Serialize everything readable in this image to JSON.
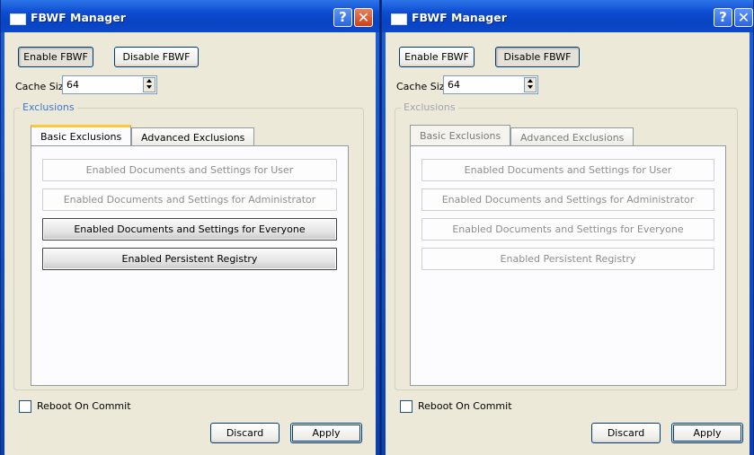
{
  "colors": {
    "title_blue": "#0843c2",
    "dialog_bg": "#ece9d8",
    "groupbox_label": "#3c76d6",
    "tab_highlight": "#ffc83c"
  },
  "windows": [
    {
      "title": "FBWF Manager",
      "help_glyph": "?",
      "close_glyph": "✕",
      "enable_label": "Enable FBWF",
      "disable_label": "Disable FBWF",
      "pressed_button": "enable",
      "cache_label": "Cache Size",
      "cache_value": "64",
      "group_label": "Exclusions",
      "tabs": [
        {
          "label": "Basic Exclusions"
        },
        {
          "label": "Advanced Exclusions"
        }
      ],
      "tabs_enabled": true,
      "exclusions": [
        {
          "label": "Enabled Documents and Settings for User",
          "enabled": false
        },
        {
          "label": "Enabled Documents and Settings for Administrator",
          "enabled": false
        },
        {
          "label": "Enabled Documents and Settings for Everyone",
          "enabled": true
        },
        {
          "label": "Enabled Persistent Registry",
          "enabled": true
        }
      ],
      "reboot_label": "Reboot On Commit",
      "discard_label": "Discard",
      "apply_label": "Apply"
    },
    {
      "title": "FBWF Manager",
      "help_glyph": "?",
      "close_glyph": "✕",
      "enable_label": "Enable FBWF",
      "disable_label": "Disable FBWF",
      "pressed_button": "disable",
      "cache_label": "Cache Size",
      "cache_value": "64",
      "group_label": "Exclusions",
      "tabs": [
        {
          "label": "Basic Exclusions"
        },
        {
          "label": "Advanced Exclusions"
        }
      ],
      "tabs_enabled": false,
      "exclusions": [
        {
          "label": "Enabled Documents and Settings for User",
          "enabled": false
        },
        {
          "label": "Enabled Documents and Settings for Administrator",
          "enabled": false
        },
        {
          "label": "Enabled Documents and Settings for Everyone",
          "enabled": false
        },
        {
          "label": "Enabled Persistent Registry",
          "enabled": false
        }
      ],
      "reboot_label": "Reboot On Commit",
      "discard_label": "Discard",
      "apply_label": "Apply"
    }
  ]
}
